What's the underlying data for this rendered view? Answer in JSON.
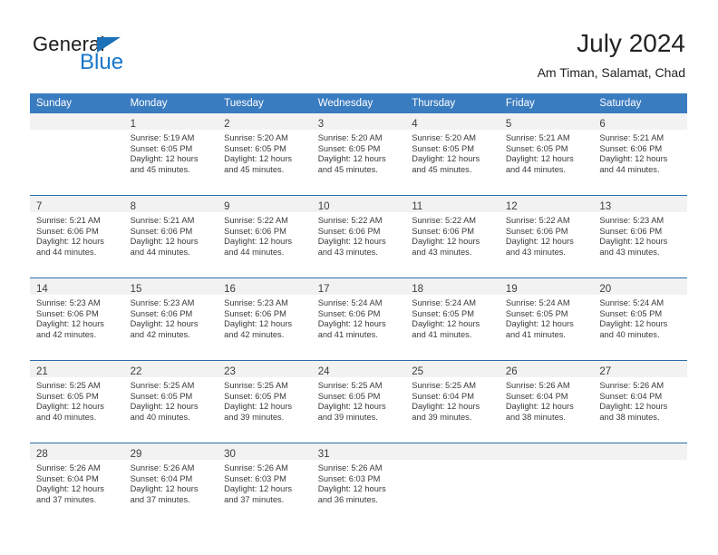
{
  "brand": {
    "name_part1": "General",
    "name_part2": "Blue",
    "triangle_color": "#1d71b8",
    "blue_color": "#1877c9"
  },
  "header": {
    "title": "July 2024",
    "subtitle": "Am Timan, Salamat, Chad"
  },
  "theme": {
    "header_bg": "#3a7cc0",
    "row_divider": "#2b6cad",
    "daynum_band": "#f2f2f2"
  },
  "calendar": {
    "weekday_headers": [
      "Sunday",
      "Monday",
      "Tuesday",
      "Wednesday",
      "Thursday",
      "Friday",
      "Saturday"
    ],
    "weeks": [
      [
        {
          "day": "",
          "lines": []
        },
        {
          "day": "1",
          "lines": [
            "Sunrise: 5:19 AM",
            "Sunset: 6:05 PM",
            "Daylight: 12 hours",
            "and 45 minutes."
          ]
        },
        {
          "day": "2",
          "lines": [
            "Sunrise: 5:20 AM",
            "Sunset: 6:05 PM",
            "Daylight: 12 hours",
            "and 45 minutes."
          ]
        },
        {
          "day": "3",
          "lines": [
            "Sunrise: 5:20 AM",
            "Sunset: 6:05 PM",
            "Daylight: 12 hours",
            "and 45 minutes."
          ]
        },
        {
          "day": "4",
          "lines": [
            "Sunrise: 5:20 AM",
            "Sunset: 6:05 PM",
            "Daylight: 12 hours",
            "and 45 minutes."
          ]
        },
        {
          "day": "5",
          "lines": [
            "Sunrise: 5:21 AM",
            "Sunset: 6:05 PM",
            "Daylight: 12 hours",
            "and 44 minutes."
          ]
        },
        {
          "day": "6",
          "lines": [
            "Sunrise: 5:21 AM",
            "Sunset: 6:06 PM",
            "Daylight: 12 hours",
            "and 44 minutes."
          ]
        }
      ],
      [
        {
          "day": "7",
          "lines": [
            "Sunrise: 5:21 AM",
            "Sunset: 6:06 PM",
            "Daylight: 12 hours",
            "and 44 minutes."
          ]
        },
        {
          "day": "8",
          "lines": [
            "Sunrise: 5:21 AM",
            "Sunset: 6:06 PM",
            "Daylight: 12 hours",
            "and 44 minutes."
          ]
        },
        {
          "day": "9",
          "lines": [
            "Sunrise: 5:22 AM",
            "Sunset: 6:06 PM",
            "Daylight: 12 hours",
            "and 44 minutes."
          ]
        },
        {
          "day": "10",
          "lines": [
            "Sunrise: 5:22 AM",
            "Sunset: 6:06 PM",
            "Daylight: 12 hours",
            "and 43 minutes."
          ]
        },
        {
          "day": "11",
          "lines": [
            "Sunrise: 5:22 AM",
            "Sunset: 6:06 PM",
            "Daylight: 12 hours",
            "and 43 minutes."
          ]
        },
        {
          "day": "12",
          "lines": [
            "Sunrise: 5:22 AM",
            "Sunset: 6:06 PM",
            "Daylight: 12 hours",
            "and 43 minutes."
          ]
        },
        {
          "day": "13",
          "lines": [
            "Sunrise: 5:23 AM",
            "Sunset: 6:06 PM",
            "Daylight: 12 hours",
            "and 43 minutes."
          ]
        }
      ],
      [
        {
          "day": "14",
          "lines": [
            "Sunrise: 5:23 AM",
            "Sunset: 6:06 PM",
            "Daylight: 12 hours",
            "and 42 minutes."
          ]
        },
        {
          "day": "15",
          "lines": [
            "Sunrise: 5:23 AM",
            "Sunset: 6:06 PM",
            "Daylight: 12 hours",
            "and 42 minutes."
          ]
        },
        {
          "day": "16",
          "lines": [
            "Sunrise: 5:23 AM",
            "Sunset: 6:06 PM",
            "Daylight: 12 hours",
            "and 42 minutes."
          ]
        },
        {
          "day": "17",
          "lines": [
            "Sunrise: 5:24 AM",
            "Sunset: 6:06 PM",
            "Daylight: 12 hours",
            "and 41 minutes."
          ]
        },
        {
          "day": "18",
          "lines": [
            "Sunrise: 5:24 AM",
            "Sunset: 6:05 PM",
            "Daylight: 12 hours",
            "and 41 minutes."
          ]
        },
        {
          "day": "19",
          "lines": [
            "Sunrise: 5:24 AM",
            "Sunset: 6:05 PM",
            "Daylight: 12 hours",
            "and 41 minutes."
          ]
        },
        {
          "day": "20",
          "lines": [
            "Sunrise: 5:24 AM",
            "Sunset: 6:05 PM",
            "Daylight: 12 hours",
            "and 40 minutes."
          ]
        }
      ],
      [
        {
          "day": "21",
          "lines": [
            "Sunrise: 5:25 AM",
            "Sunset: 6:05 PM",
            "Daylight: 12 hours",
            "and 40 minutes."
          ]
        },
        {
          "day": "22",
          "lines": [
            "Sunrise: 5:25 AM",
            "Sunset: 6:05 PM",
            "Daylight: 12 hours",
            "and 40 minutes."
          ]
        },
        {
          "day": "23",
          "lines": [
            "Sunrise: 5:25 AM",
            "Sunset: 6:05 PM",
            "Daylight: 12 hours",
            "and 39 minutes."
          ]
        },
        {
          "day": "24",
          "lines": [
            "Sunrise: 5:25 AM",
            "Sunset: 6:05 PM",
            "Daylight: 12 hours",
            "and 39 minutes."
          ]
        },
        {
          "day": "25",
          "lines": [
            "Sunrise: 5:25 AM",
            "Sunset: 6:04 PM",
            "Daylight: 12 hours",
            "and 39 minutes."
          ]
        },
        {
          "day": "26",
          "lines": [
            "Sunrise: 5:26 AM",
            "Sunset: 6:04 PM",
            "Daylight: 12 hours",
            "and 38 minutes."
          ]
        },
        {
          "day": "27",
          "lines": [
            "Sunrise: 5:26 AM",
            "Sunset: 6:04 PM",
            "Daylight: 12 hours",
            "and 38 minutes."
          ]
        }
      ],
      [
        {
          "day": "28",
          "lines": [
            "Sunrise: 5:26 AM",
            "Sunset: 6:04 PM",
            "Daylight: 12 hours",
            "and 37 minutes."
          ]
        },
        {
          "day": "29",
          "lines": [
            "Sunrise: 5:26 AM",
            "Sunset: 6:04 PM",
            "Daylight: 12 hours",
            "and 37 minutes."
          ]
        },
        {
          "day": "30",
          "lines": [
            "Sunrise: 5:26 AM",
            "Sunset: 6:03 PM",
            "Daylight: 12 hours",
            "and 37 minutes."
          ]
        },
        {
          "day": "31",
          "lines": [
            "Sunrise: 5:26 AM",
            "Sunset: 6:03 PM",
            "Daylight: 12 hours",
            "and 36 minutes."
          ]
        },
        {
          "day": "",
          "lines": []
        },
        {
          "day": "",
          "lines": []
        },
        {
          "day": "",
          "lines": []
        }
      ]
    ]
  }
}
